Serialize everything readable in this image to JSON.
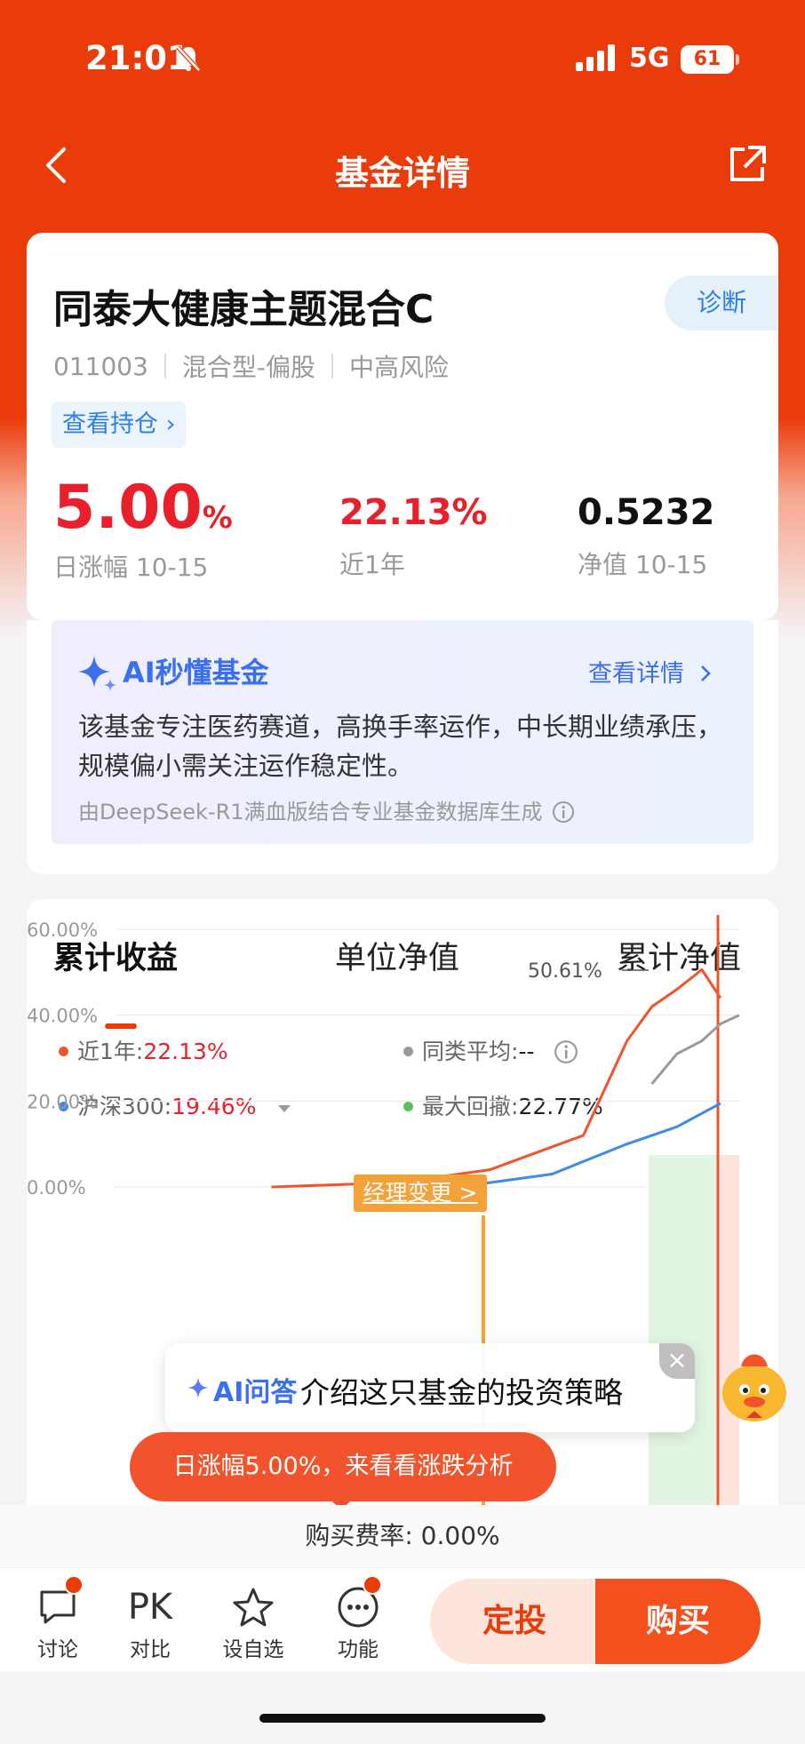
{
  "status": {
    "time": "21:01",
    "network": "5G",
    "battery": "61"
  },
  "nav": {
    "title": "基金详情"
  },
  "fund": {
    "name": "同泰大健康主题混合C",
    "diagnose": "诊断",
    "code": "011003",
    "type": "混合型-偏股",
    "risk": "中高风险",
    "holdings_link": "查看持仓 ›",
    "daily_change": "5.00",
    "daily_change_unit": "%",
    "daily_change_label": "日涨幅 10-15",
    "year_return": "22.13%",
    "year_return_label": "近1年",
    "nav_value": "0.5232",
    "nav_label": "净值 10-15"
  },
  "ai_summary": {
    "title": "AI秒懂基金",
    "link": "查看详情",
    "body": "该基金专注医药赛道，高换手率运作，中长期业绩承压，规模偏小需关注运作稳定性。",
    "footer": "由DeepSeek-R1满血版结合专业基金数据库生成"
  },
  "chart_tabs": [
    "累计收益",
    "单位净值",
    "累计净值"
  ],
  "legend": {
    "fund_label": "近1年:",
    "fund_value": "22.13%",
    "peer_label": "同类平均:",
    "peer_value": "--",
    "index_label": "沪深300:",
    "index_value": "19.46%",
    "drawdown_label": "最大回撤:",
    "drawdown_value": "22.77%"
  },
  "chart_annotations": {
    "manager_change": "经理变更 >",
    "peak": "50.61%"
  },
  "chart_data": {
    "type": "line",
    "ylim": [
      0,
      60
    ],
    "yticks": [
      "60.00%",
      "40.00%",
      "20.00%",
      "0.00%"
    ],
    "series": [
      {
        "name": "近1年",
        "color": "#f1542c",
        "points": [
          [
            0.25,
            0
          ],
          [
            0.45,
            1
          ],
          [
            0.6,
            4
          ],
          [
            0.75,
            12
          ],
          [
            0.82,
            34
          ],
          [
            0.86,
            42
          ],
          [
            0.9,
            46
          ],
          [
            0.94,
            50.61
          ],
          [
            0.97,
            44
          ]
        ]
      },
      {
        "name": "同类平均",
        "color": "#9a9a9a",
        "points": [
          [
            0.86,
            24
          ],
          [
            0.9,
            31
          ],
          [
            0.94,
            34
          ],
          [
            0.97,
            38
          ],
          [
            1.0,
            40
          ]
        ]
      },
      {
        "name": "沪深300",
        "color": "#3d8ae8",
        "points": [
          [
            0.55,
            0
          ],
          [
            0.7,
            3
          ],
          [
            0.82,
            10
          ],
          [
            0.9,
            14
          ],
          [
            0.97,
            19.46
          ]
        ]
      }
    ]
  },
  "ai_qa": {
    "label": "AI问答",
    "text": "介绍这只基金的投资策略",
    "close": "×"
  },
  "analysis_bubble": "日涨幅5.00%，来看看涨跌分析",
  "fee": "购买费率: 0.00%",
  "bottom": {
    "discuss": "讨论",
    "pk": "PK",
    "compare": "对比",
    "watchlist": "设自选",
    "functions": "功能",
    "sip": "定投",
    "buy": "购买"
  },
  "colors": {
    "brand": "#ea3b0b",
    "up": "#e8202c",
    "ai": "#3a6fee"
  }
}
